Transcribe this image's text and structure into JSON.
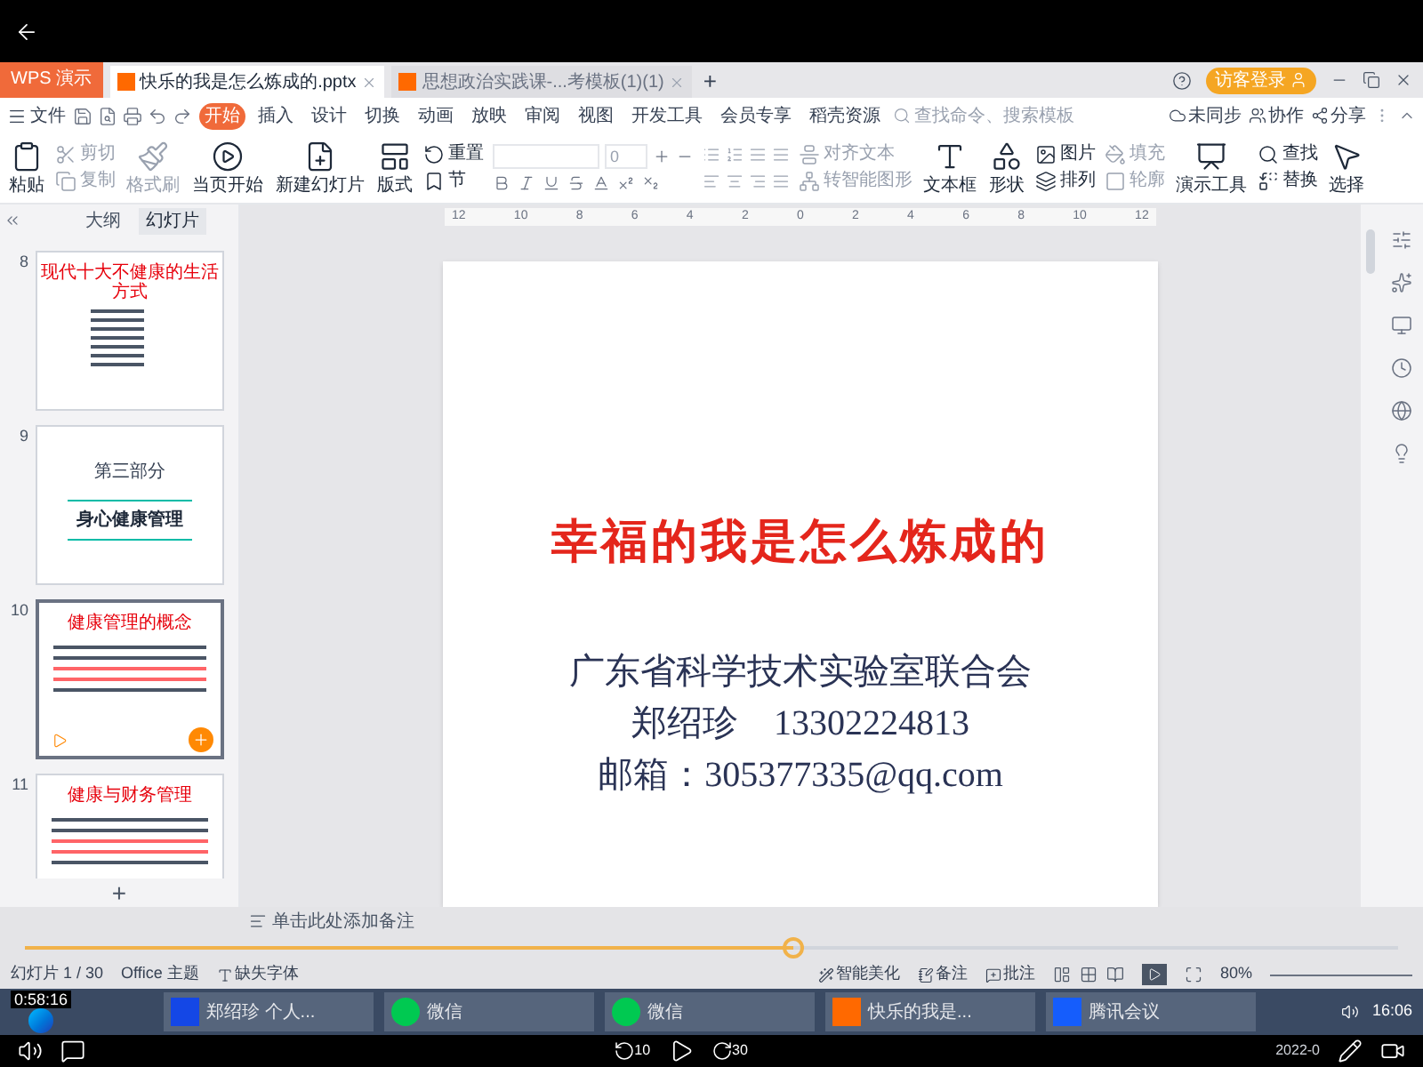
{
  "title_bar": {
    "app": "WPS 演示",
    "tabs": [
      {
        "label": "快乐的我是怎么炼成的.pptx",
        "selected": true
      },
      {
        "label": "思想政治实践课-...考模板(1)(1)",
        "selected": false
      }
    ],
    "new_tab": "+",
    "login": "访客登录"
  },
  "menu": {
    "file": "文件",
    "tabs": [
      {
        "label": "开始",
        "selected": true
      },
      {
        "label": "插入",
        "selected": false
      },
      {
        "label": "设计",
        "selected": false
      },
      {
        "label": "切换",
        "selected": false
      },
      {
        "label": "动画",
        "selected": false
      },
      {
        "label": "放映",
        "selected": false
      },
      {
        "label": "审阅",
        "selected": false
      },
      {
        "label": "视图",
        "selected": false
      },
      {
        "label": "开发工具",
        "selected": false
      },
      {
        "label": "会员专享",
        "selected": false
      },
      {
        "label": "稻壳资源",
        "selected": false
      }
    ],
    "search": {
      "placeholder": "查找命令、搜索模板"
    },
    "actions": [
      "未同步",
      "协作",
      "分享"
    ]
  },
  "ribbon": [
    {
      "kind": "large",
      "items": [
        {
          "label": "粘贴",
          "disabled": false
        }
      ]
    },
    {
      "kind": "stack",
      "items": [
        {
          "label": "剪切",
          "disabled": true
        },
        {
          "label": "复制",
          "disabled": true
        }
      ]
    },
    {
      "kind": "large",
      "items": [
        {
          "label": "格式刷",
          "disabled": true
        }
      ]
    },
    {
      "kind": "large",
      "items": [
        {
          "label": "当页开始",
          "disabled": false
        }
      ]
    },
    {
      "kind": "large",
      "items": [
        {
          "label": "新建幻灯片",
          "disabled": false
        }
      ]
    },
    {
      "kind": "large",
      "items": [
        {
          "label": "版式",
          "disabled": false
        }
      ]
    },
    {
      "kind": "stack",
      "items": [
        {
          "label": "重置",
          "disabled": false
        },
        {
          "label": "节",
          "disabled": false
        }
      ]
    },
    {
      "kind": "font",
      "size": "0"
    },
    {
      "kind": "stack",
      "items": [
        {
          "label": "对齐文本",
          "disabled": true
        },
        {
          "label": "转智能图形",
          "disabled": true
        }
      ]
    },
    {
      "kind": "large",
      "items": [
        {
          "label": "文本框",
          "disabled": false
        }
      ]
    },
    {
      "kind": "large",
      "items": [
        {
          "label": "形状",
          "disabled": false
        }
      ]
    },
    {
      "kind": "stack",
      "items": [
        {
          "label": "图片",
          "disabled": false
        },
        {
          "label": "排列",
          "disabled": false
        }
      ]
    },
    {
      "kind": "stack",
      "items": [
        {
          "label": "填充",
          "disabled": true
        },
        {
          "label": "轮廓",
          "disabled": true
        }
      ]
    },
    {
      "kind": "large",
      "items": [
        {
          "label": "演示工具",
          "disabled": false
        }
      ]
    },
    {
      "kind": "stack",
      "items": [
        {
          "label": "查找",
          "disabled": false
        },
        {
          "label": "替换",
          "disabled": false
        }
      ]
    },
    {
      "kind": "large",
      "items": [
        {
          "label": "选择",
          "disabled": false
        }
      ]
    }
  ],
  "panel": {
    "tabs": [
      {
        "label": "大纲",
        "selected": false
      },
      {
        "label": "幻灯片",
        "selected": true
      }
    ],
    "slides": [
      {
        "number": "8",
        "kind": "list",
        "selected": false,
        "title": "现代十大不健康的生活方式"
      },
      {
        "number": "9",
        "kind": "section",
        "selected": false,
        "heading": "第三部分",
        "title": "身心健康管理"
      },
      {
        "number": "10",
        "kind": "text",
        "selected": true,
        "title": "健康管理的概念"
      },
      {
        "number": "11",
        "kind": "text",
        "selected": false,
        "title": "健康与财务管理"
      }
    ],
    "add": "+"
  },
  "ruler_labels": [
    "12",
    "10",
    "8",
    "6",
    "4",
    "2",
    "0",
    "2",
    "4",
    "6",
    "8",
    "10",
    "12"
  ],
  "slide": {
    "title": "幸福的我是怎么炼成的",
    "organization": "广东省科学技术实验室联合会",
    "contact_name": "郑绍珍",
    "phone": "13302224813",
    "email": "邮箱：305377335@qq.com"
  },
  "notes": {
    "placeholder": "单击此处添加备注"
  },
  "video": {
    "time": "0:58:16",
    "level": 0.56
  },
  "status_bar": {
    "slide_count": "幻灯片 1 / 30",
    "theme": "Office 主题",
    "missing_fonts": "缺失字体",
    "beautify": "智能美化",
    "notes": "备注",
    "comments": "批注",
    "zoom": "80%"
  },
  "taskbar": {
    "apps": [
      {
        "label": "郑绍珍 个人...",
        "kind": "word"
      },
      {
        "label": "微信",
        "kind": "wechat"
      },
      {
        "label": "微信",
        "kind": "wechat"
      },
      {
        "label": "快乐的我是...",
        "kind": "wps"
      },
      {
        "label": "腾讯会议",
        "kind": "meeting"
      }
    ],
    "skip_back": "10",
    "skip_forward": "30",
    "clock": "16:06",
    "date": "2022-0"
  }
}
